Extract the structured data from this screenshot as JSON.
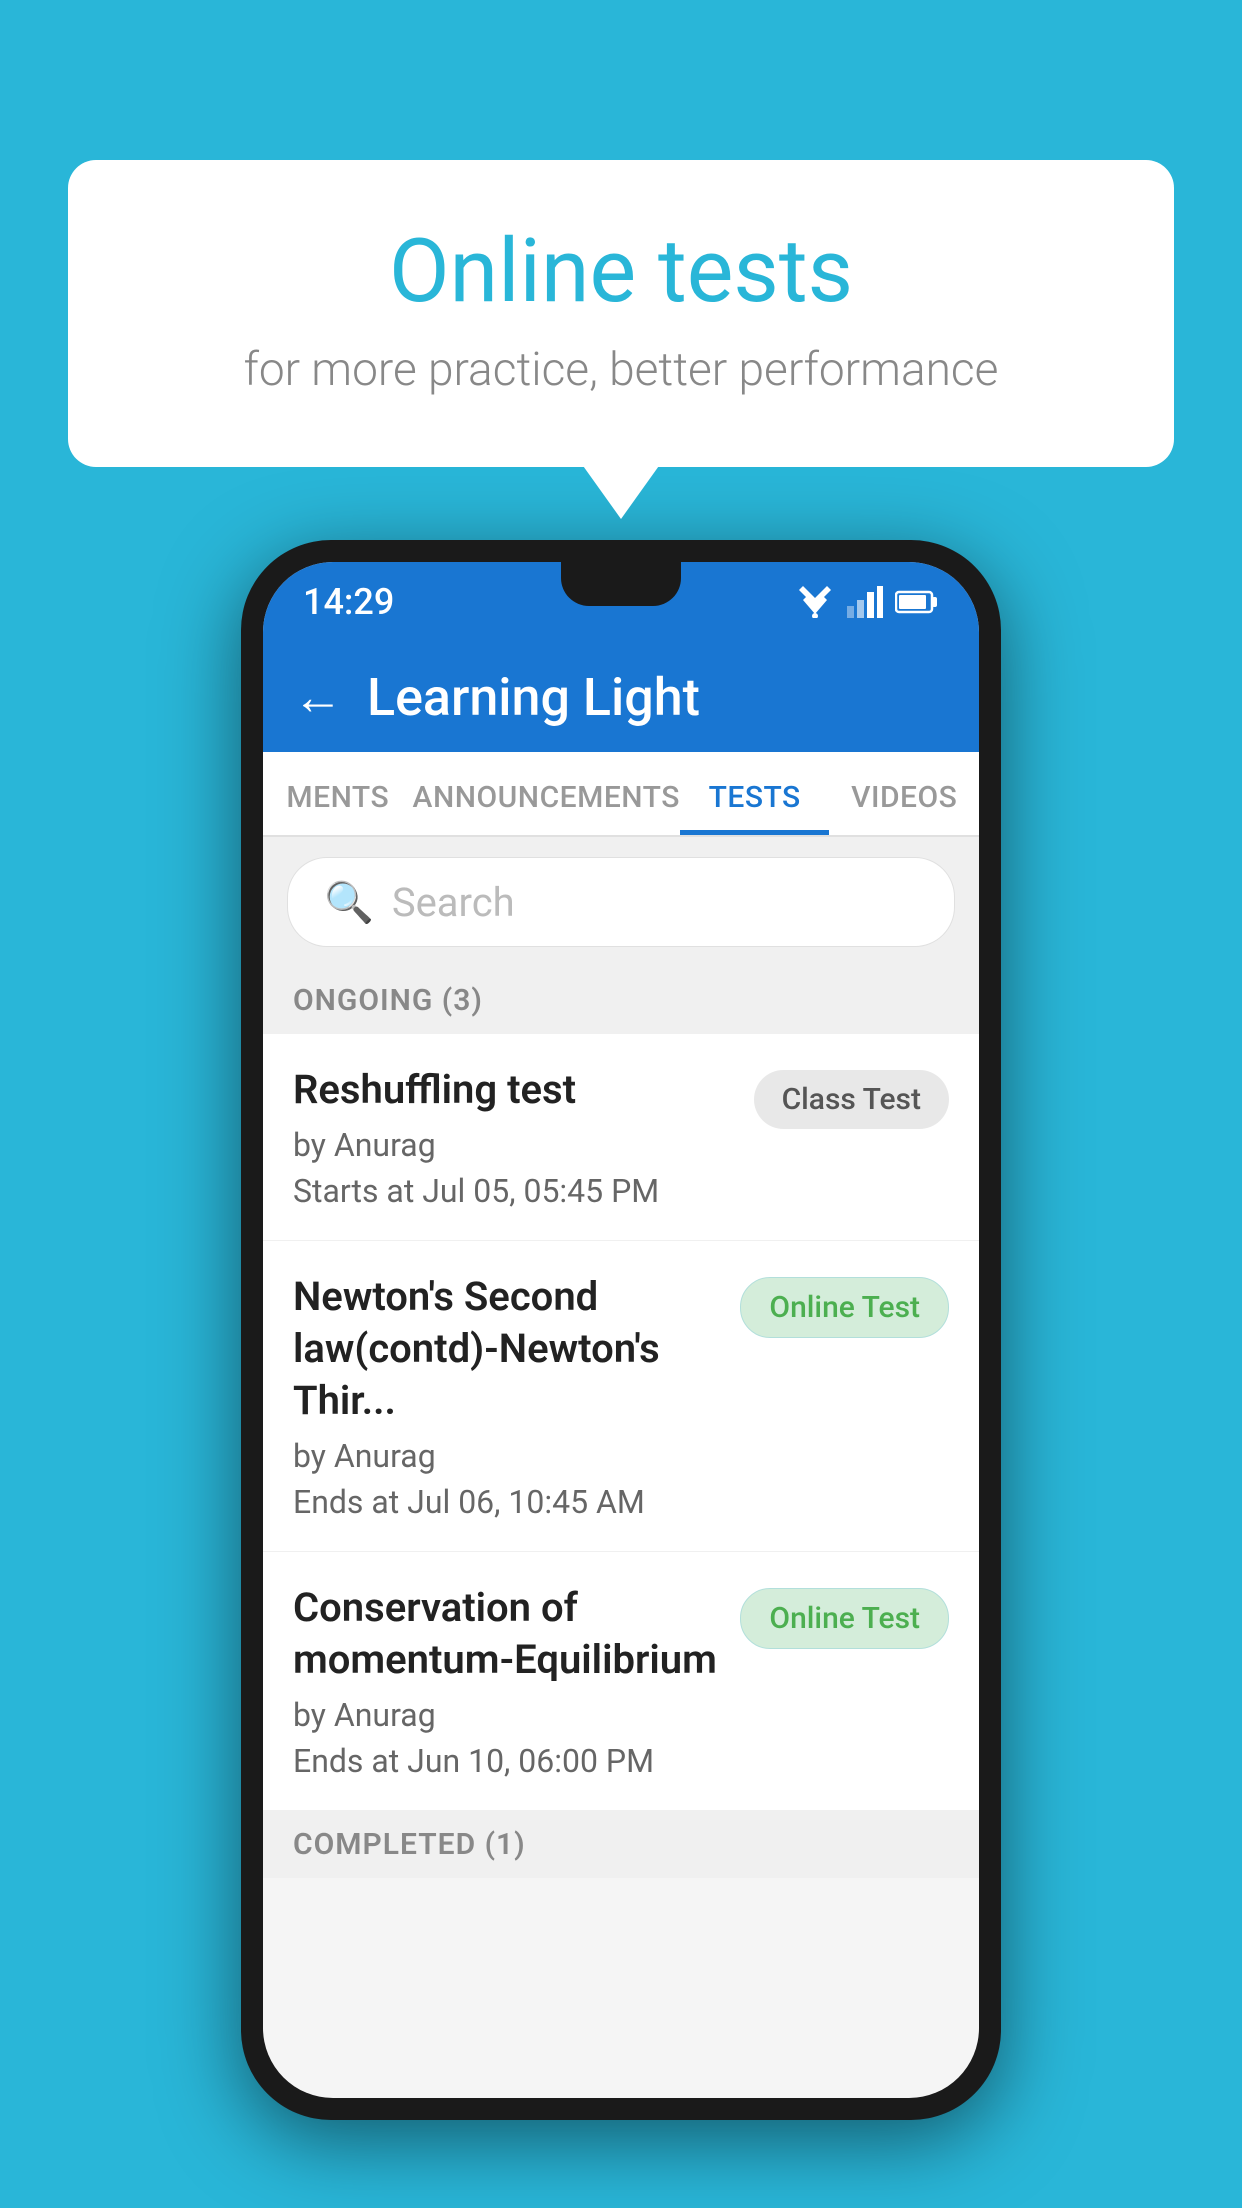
{
  "background": {
    "color": "#29B6D8"
  },
  "speech_bubble": {
    "title": "Online tests",
    "subtitle": "for more practice, better performance"
  },
  "phone": {
    "status_bar": {
      "time": "14:29"
    },
    "app_bar": {
      "title": "Learning Light",
      "back_icon": "←"
    },
    "tabs": [
      {
        "label": "MENTS",
        "active": false
      },
      {
        "label": "ANNOUNCEMENTS",
        "active": false
      },
      {
        "label": "TESTS",
        "active": true
      },
      {
        "label": "VIDEOS",
        "active": false
      }
    ],
    "search": {
      "placeholder": "Search"
    },
    "ongoing_section": {
      "label": "ONGOING (3)"
    },
    "test_items": [
      {
        "title": "Reshuffling test",
        "author": "by Anurag",
        "time_label": "Starts at",
        "time": "Jul 05, 05:45 PM",
        "badge": "Class Test",
        "badge_type": "class"
      },
      {
        "title": "Newton's Second law(contd)-Newton's Thir...",
        "author": "by Anurag",
        "time_label": "Ends at",
        "time": "Jul 06, 10:45 AM",
        "badge": "Online Test",
        "badge_type": "online"
      },
      {
        "title": "Conservation of momentum-Equilibrium",
        "author": "by Anurag",
        "time_label": "Ends at",
        "time": "Jun 10, 06:00 PM",
        "badge": "Online Test",
        "badge_type": "online"
      }
    ],
    "completed_section": {
      "label": "COMPLETED (1)"
    }
  }
}
